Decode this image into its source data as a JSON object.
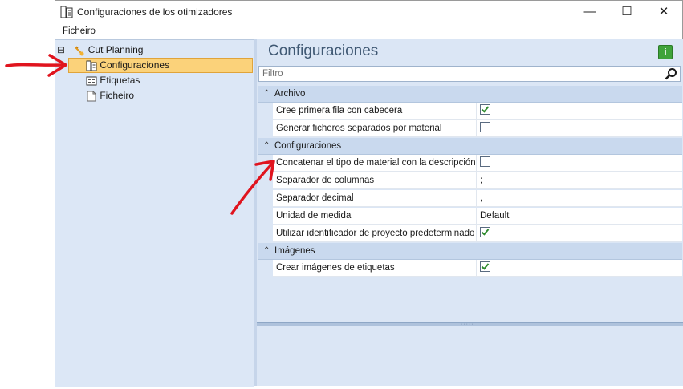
{
  "window": {
    "title": "Configuraciones de los otimizadores",
    "controls": {
      "minimize": "—",
      "maximize": "☐",
      "close": "✕"
    }
  },
  "menu": {
    "file": "Ficheiro"
  },
  "tree": {
    "collapse_glyph": "⊟",
    "root": {
      "label": "Cut Planning",
      "icon": "cut-planning-icon"
    },
    "children": [
      {
        "label": "Configuraciones",
        "icon": "settings-document-icon",
        "selected": true
      },
      {
        "label": "Etiquetas",
        "icon": "labels-icon",
        "selected": false
      },
      {
        "label": "Ficheiro",
        "icon": "file-icon",
        "selected": false
      }
    ]
  },
  "content": {
    "title": "Configuraciones",
    "info_icon_label": "i",
    "filter_placeholder": "Filtro"
  },
  "grid": {
    "collapse_glyph": "⌃",
    "categories": [
      {
        "label": "Archivo",
        "rows": [
          {
            "name": "Cree primera fila con cabecera",
            "type": "checkbox",
            "checked": true
          },
          {
            "name": "Generar ficheros separados por material",
            "type": "checkbox",
            "checked": false
          }
        ]
      },
      {
        "label": "Configuraciones",
        "rows": [
          {
            "name": "Concatenar el tipo de material con la descripción",
            "type": "checkbox",
            "checked": false
          },
          {
            "name": "Separador de columnas",
            "type": "text",
            "value": ";"
          },
          {
            "name": "Separador decimal",
            "type": "text",
            "value": ","
          },
          {
            "name": "Unidad de medida",
            "type": "text",
            "value": "Default"
          },
          {
            "name": "Utilizar identificador de proyecto predeterminado",
            "type": "checkbox",
            "checked": true
          }
        ]
      },
      {
        "label": "Imágenes",
        "rows": [
          {
            "name": "Crear imágenes de etiquetas",
            "type": "checkbox",
            "checked": true
          }
        ]
      }
    ]
  },
  "colors": {
    "panel_bg": "#dce7f6",
    "selected_bg": "#fbd27a",
    "category_bg": "#c9d9ee",
    "title_color": "#3f5873",
    "annotation_arrow": "#e0141e",
    "check_green": "#2e8b2e"
  }
}
